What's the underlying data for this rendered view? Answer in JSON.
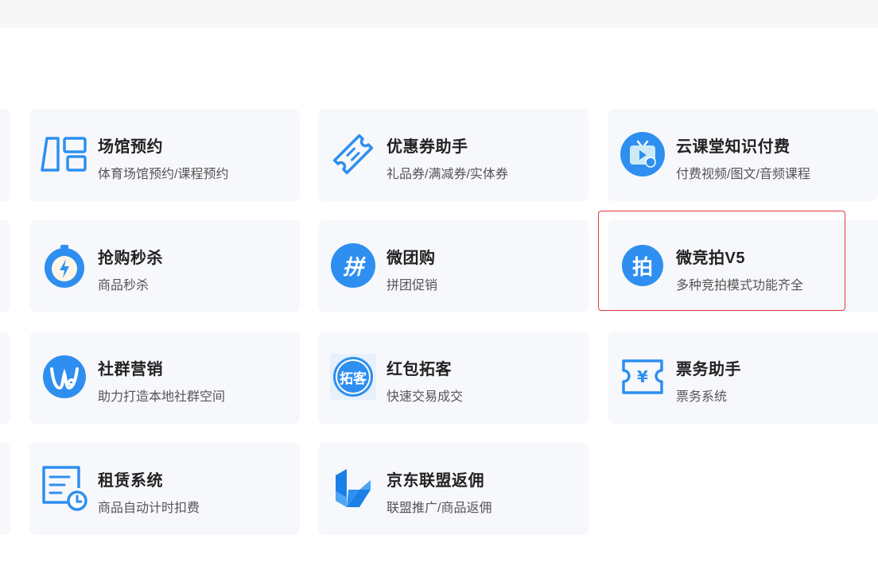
{
  "apps": [
    {
      "title": "场馆预约",
      "desc": "体育场馆预约/课程预约",
      "icon": "venue-layout-icon"
    },
    {
      "title": "优惠券助手",
      "desc": "礼品券/满减券/实体券",
      "icon": "coupon-ticket-icon"
    },
    {
      "title": "云课堂知识付费",
      "desc": "付费视频/图文/音频课程",
      "icon": "video-tv-icon"
    },
    {
      "title": "抢购秒杀",
      "desc": "商品秒杀",
      "icon": "stopwatch-lightning-icon"
    },
    {
      "title": "微团购",
      "desc": "拼团促销",
      "icon": "pin-badge-icon",
      "glyph": "拼"
    },
    {
      "title": "微竞拍V5",
      "desc": "多种竞拍模式功能齐全",
      "icon": "pai-badge-icon",
      "glyph": "拍"
    },
    {
      "title": "社群营销",
      "desc": "助力打造本地社群空间",
      "icon": "community-m-icon"
    },
    {
      "title": "红包拓客",
      "desc": "快速交易成交",
      "icon": "tuoke-badge-icon",
      "glyph": "拓客"
    },
    {
      "title": "票务助手",
      "desc": "票务系统",
      "icon": "ticket-yen-icon",
      "glyph": "¥"
    },
    {
      "title": "租赁系统",
      "desc": "商品自动计时扣费",
      "icon": "rental-document-clock-icon"
    },
    {
      "title": "京东联盟返佣",
      "desc": "联盟推广/商品返佣",
      "icon": "jd-union-logo-icon"
    }
  ],
  "colors": {
    "accent": "#2e8ff0",
    "card_bg": "#f7f8fc",
    "highlight": "#e0383e"
  }
}
